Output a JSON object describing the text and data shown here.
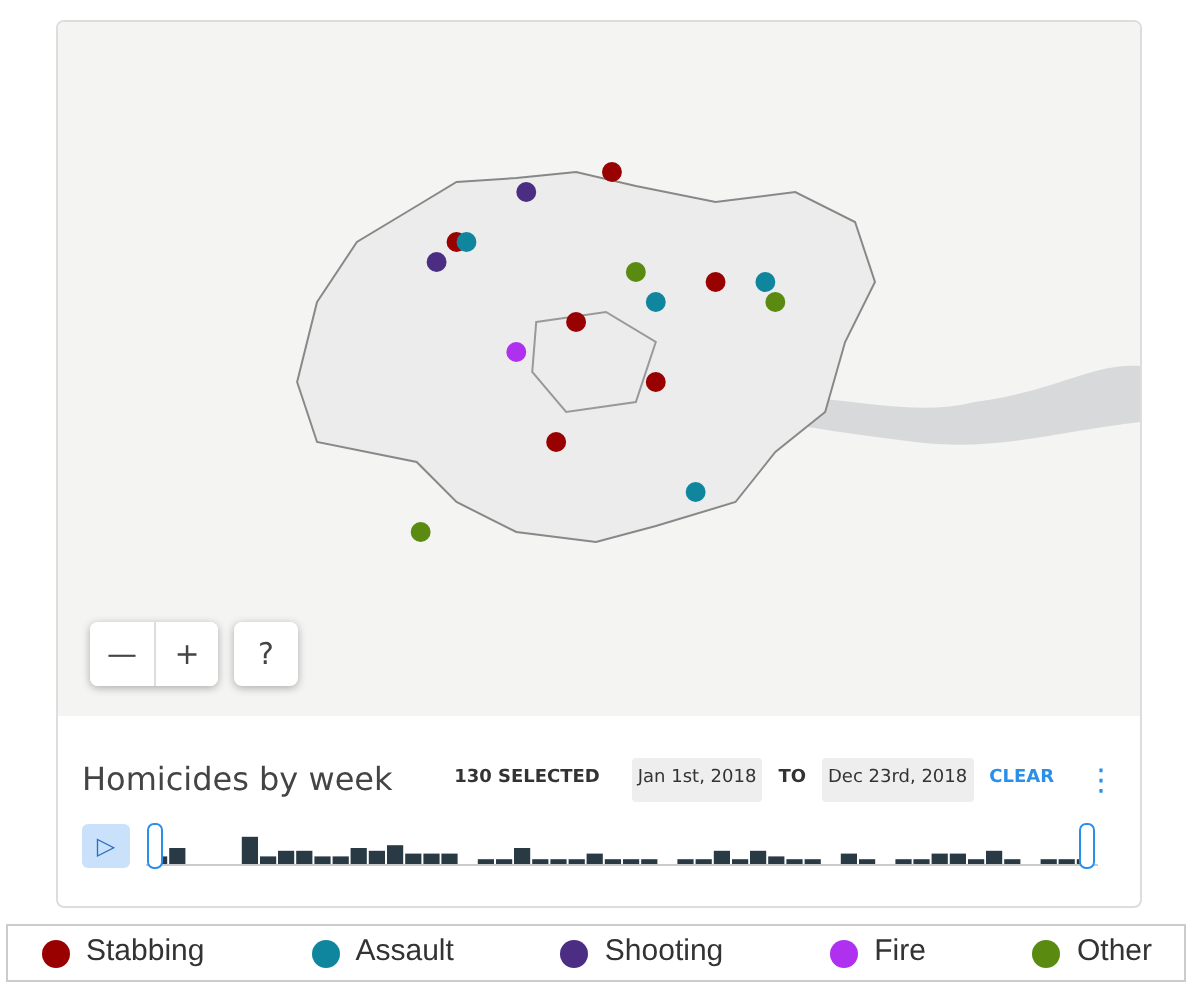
{
  "map": {
    "kind": "picture",
    "controls": [
      {
        "label": "—",
        "kind": "zoom-out"
      },
      {
        "label": "+",
        "kind": "zoom-in"
      },
      {
        "label": "?",
        "kind": "help"
      }
    ]
  },
  "timeline": {
    "title": "Homicides by week",
    "selected_count": "130 SELECTED",
    "from": "Jan 1st, 2018",
    "to_label": "TO",
    "to": "Dec 23rd, 2018",
    "clear": "CLEAR",
    "menu": "⋮",
    "play": "▷"
  },
  "legend": [
    {
      "label": "Stabbing",
      "color": "#990000"
    },
    {
      "label": "Assault",
      "color": "#10869e"
    },
    {
      "label": "Shooting",
      "color": "#4b2e83"
    },
    {
      "label": "Fire",
      "color": "#b030f0"
    },
    {
      "label": "Other",
      "color": "#5a8a10"
    }
  ]
}
